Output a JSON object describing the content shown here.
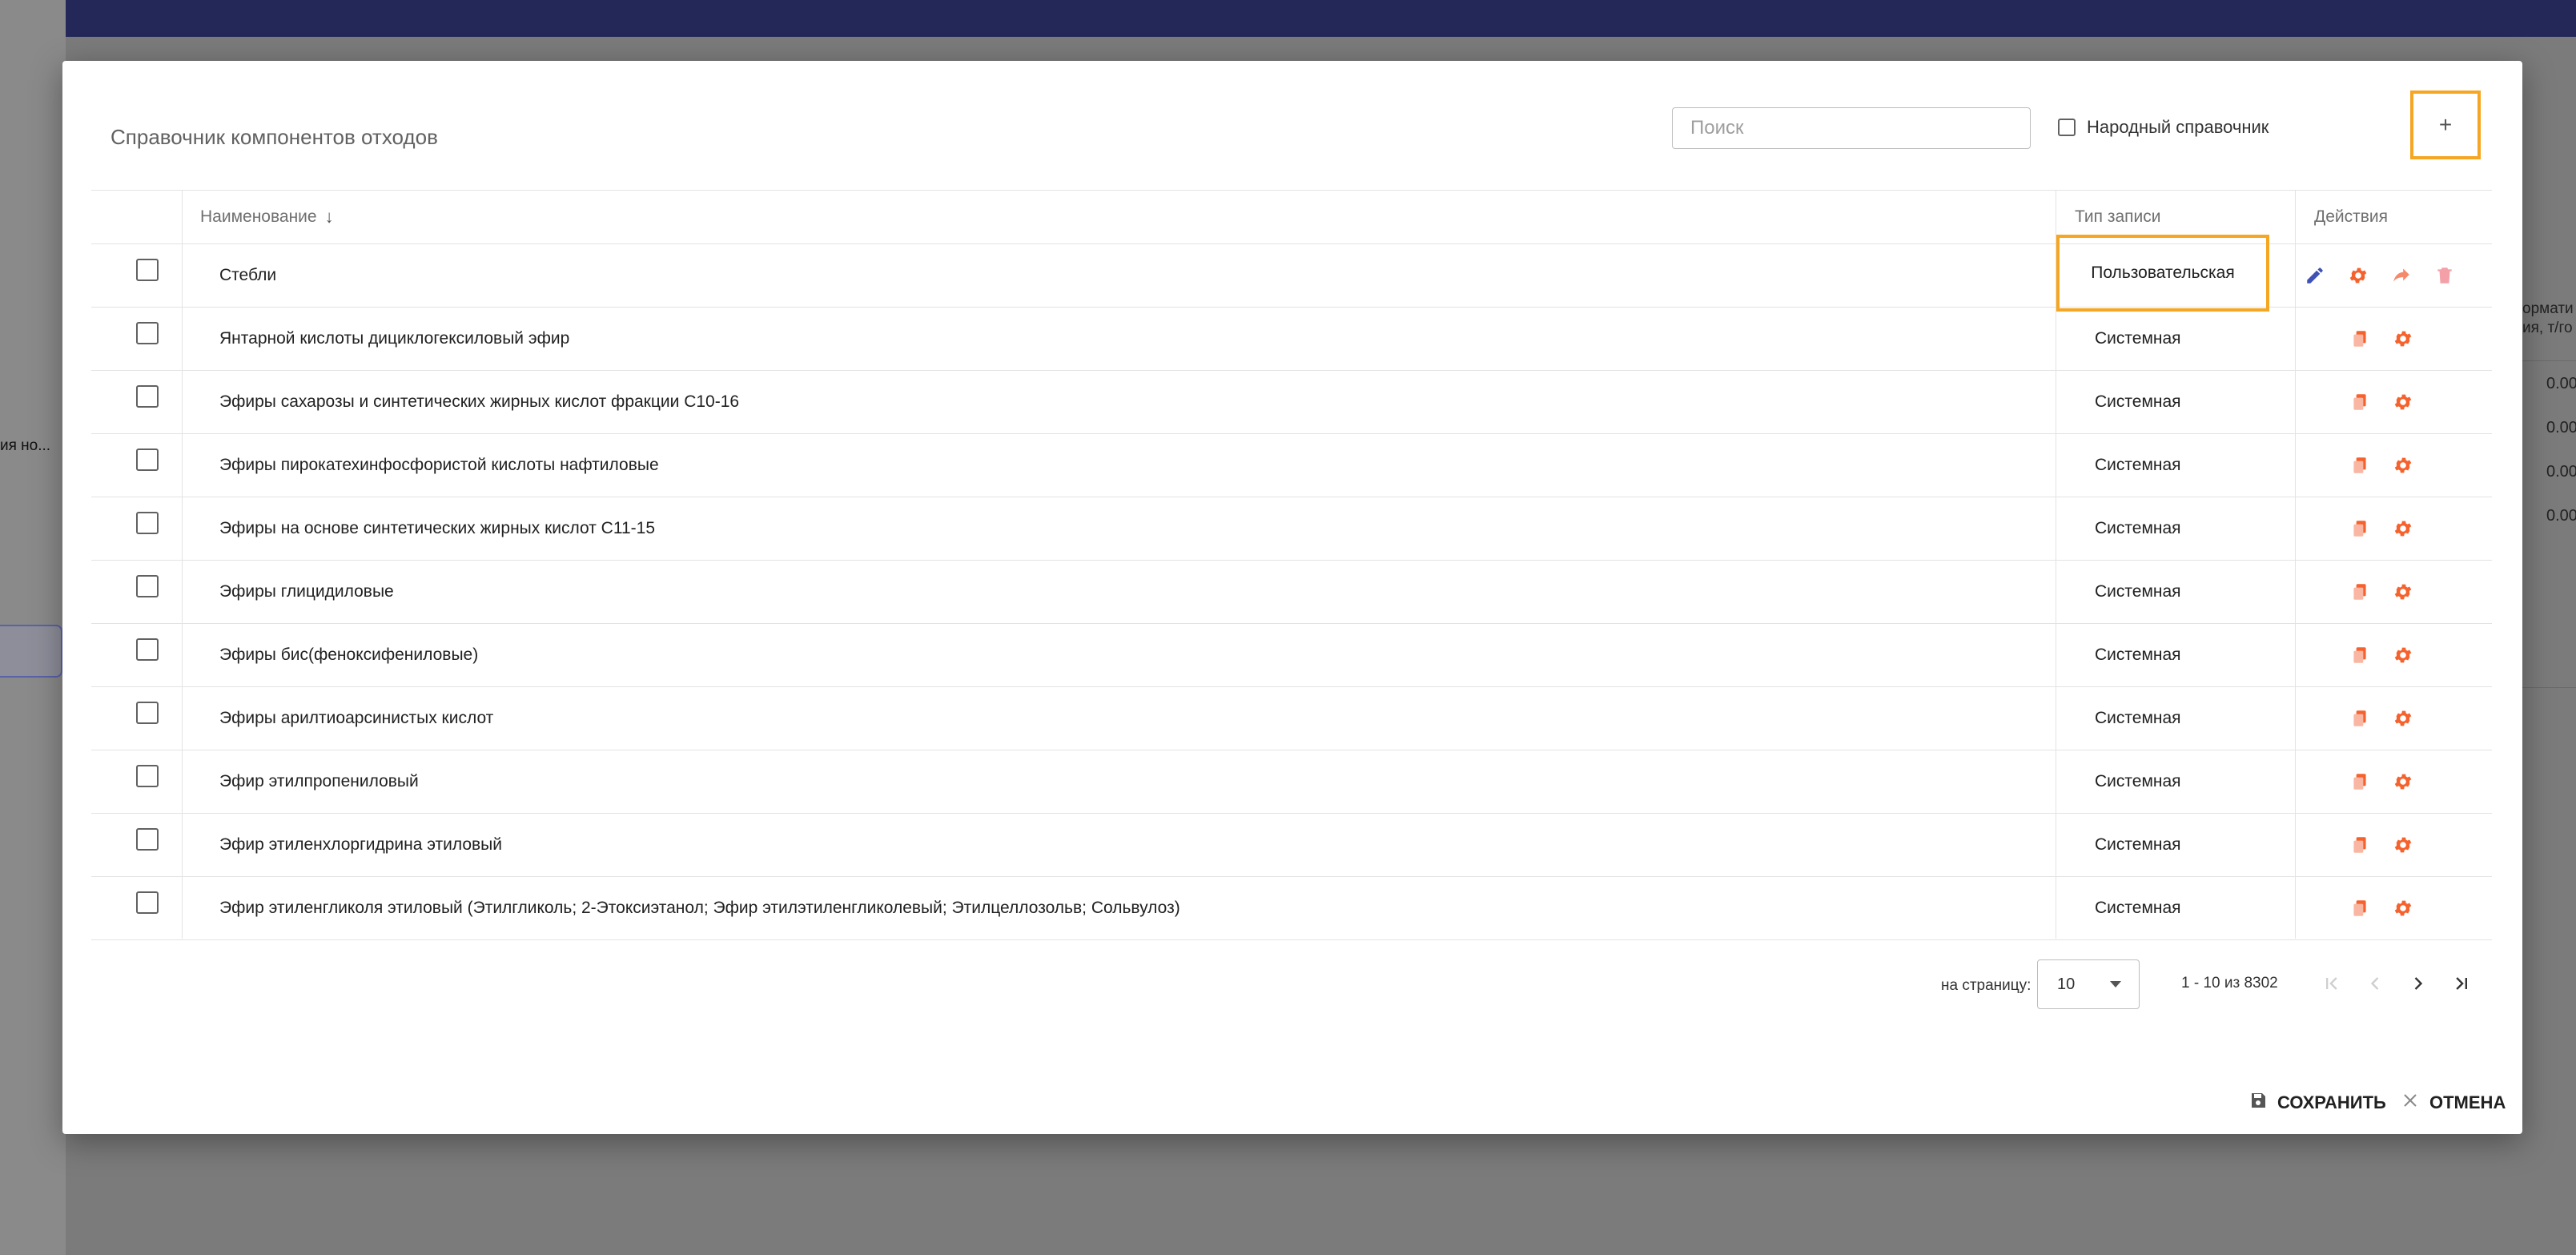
{
  "background": {
    "left_panel_text": "ия но...",
    "right_header": "ормати\nия, т/го",
    "right_values": [
      "0.00",
      "0.00",
      "0.00",
      "0.00"
    ]
  },
  "modal": {
    "title": "Справочник компонентов отходов",
    "search_placeholder": "Поиск",
    "public_reference_label": "Народный справочник",
    "add_button_label": "+",
    "columns": {
      "name": "Наименование",
      "name_sort_icon": "↓",
      "type": "Тип записи",
      "actions": "Действия"
    },
    "rows": [
      {
        "name": "Стебли",
        "type": "Пользовательская",
        "user": true
      },
      {
        "name": "Янтарной кислоты дициклогексиловый эфир",
        "type": "Системная",
        "user": false
      },
      {
        "name": "Эфиры сахарозы и синтетических жирных кислот фракции С10-16",
        "type": "Системная",
        "user": false
      },
      {
        "name": "Эфиры пирокатехинфосфористой кислоты нафтиловые",
        "type": "Системная",
        "user": false
      },
      {
        "name": "Эфиры на основе синтетических жирных кислот С11-15",
        "type": "Системная",
        "user": false
      },
      {
        "name": "Эфиры глицидиловые",
        "type": "Системная",
        "user": false
      },
      {
        "name": "Эфиры бис(феноксифениловые)",
        "type": "Системная",
        "user": false
      },
      {
        "name": "Эфиры арилтиоарсинистых кислот",
        "type": "Системная",
        "user": false
      },
      {
        "name": "Эфир этилпропениловый",
        "type": "Системная",
        "user": false
      },
      {
        "name": "Эфир этиленхлоргидрина этиловый",
        "type": "Системная",
        "user": false
      },
      {
        "name": "Эфир этиленгликоля этиловый (Этилгликоль; 2-Этоксиэтанол; Эфир этилэтиленгликолевый; Этилцеллозольв; Сольвулоз)",
        "type": "Системная",
        "user": false
      }
    ],
    "pagination": {
      "per_page_label": "на страницу:",
      "per_page_value": "10",
      "range_text": "1 - 10 из 8302"
    },
    "save_label": "СОХРАНИТЬ",
    "cancel_label": "ОТМЕНА"
  },
  "colors": {
    "accent_orange": "#f5622d",
    "highlight_border": "#f5a623",
    "edit_blue": "#3f51b5",
    "top_bar": "#232858"
  }
}
